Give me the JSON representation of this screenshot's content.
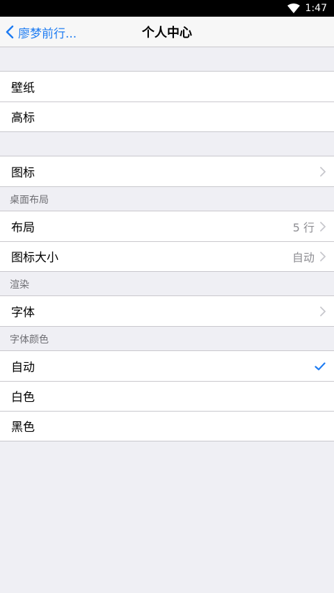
{
  "status": {
    "time": "1:47"
  },
  "nav": {
    "back_label": "廖梦前行...",
    "title": "个人中心"
  },
  "groups": {
    "wallpaper": {
      "items": [
        {
          "label": "壁纸"
        },
        {
          "label": "高标"
        }
      ]
    },
    "icons": {
      "items": [
        {
          "label": "图标"
        }
      ]
    },
    "desktop_layout": {
      "header": "桌面布局",
      "items": [
        {
          "label": "布局",
          "value": "5 行"
        },
        {
          "label": "图标大小",
          "value": "自动"
        }
      ]
    },
    "render": {
      "header": "渲染",
      "items": [
        {
          "label": "字体"
        }
      ]
    },
    "font_color": {
      "header": "字体颜色",
      "items": [
        {
          "label": "自动",
          "selected": true
        },
        {
          "label": "白色"
        },
        {
          "label": "黑色"
        }
      ]
    }
  },
  "colors": {
    "accent": "#1e7cf2",
    "background": "#efeff4",
    "separator": "#c8c7cc",
    "secondary_text": "#8e8e93"
  }
}
